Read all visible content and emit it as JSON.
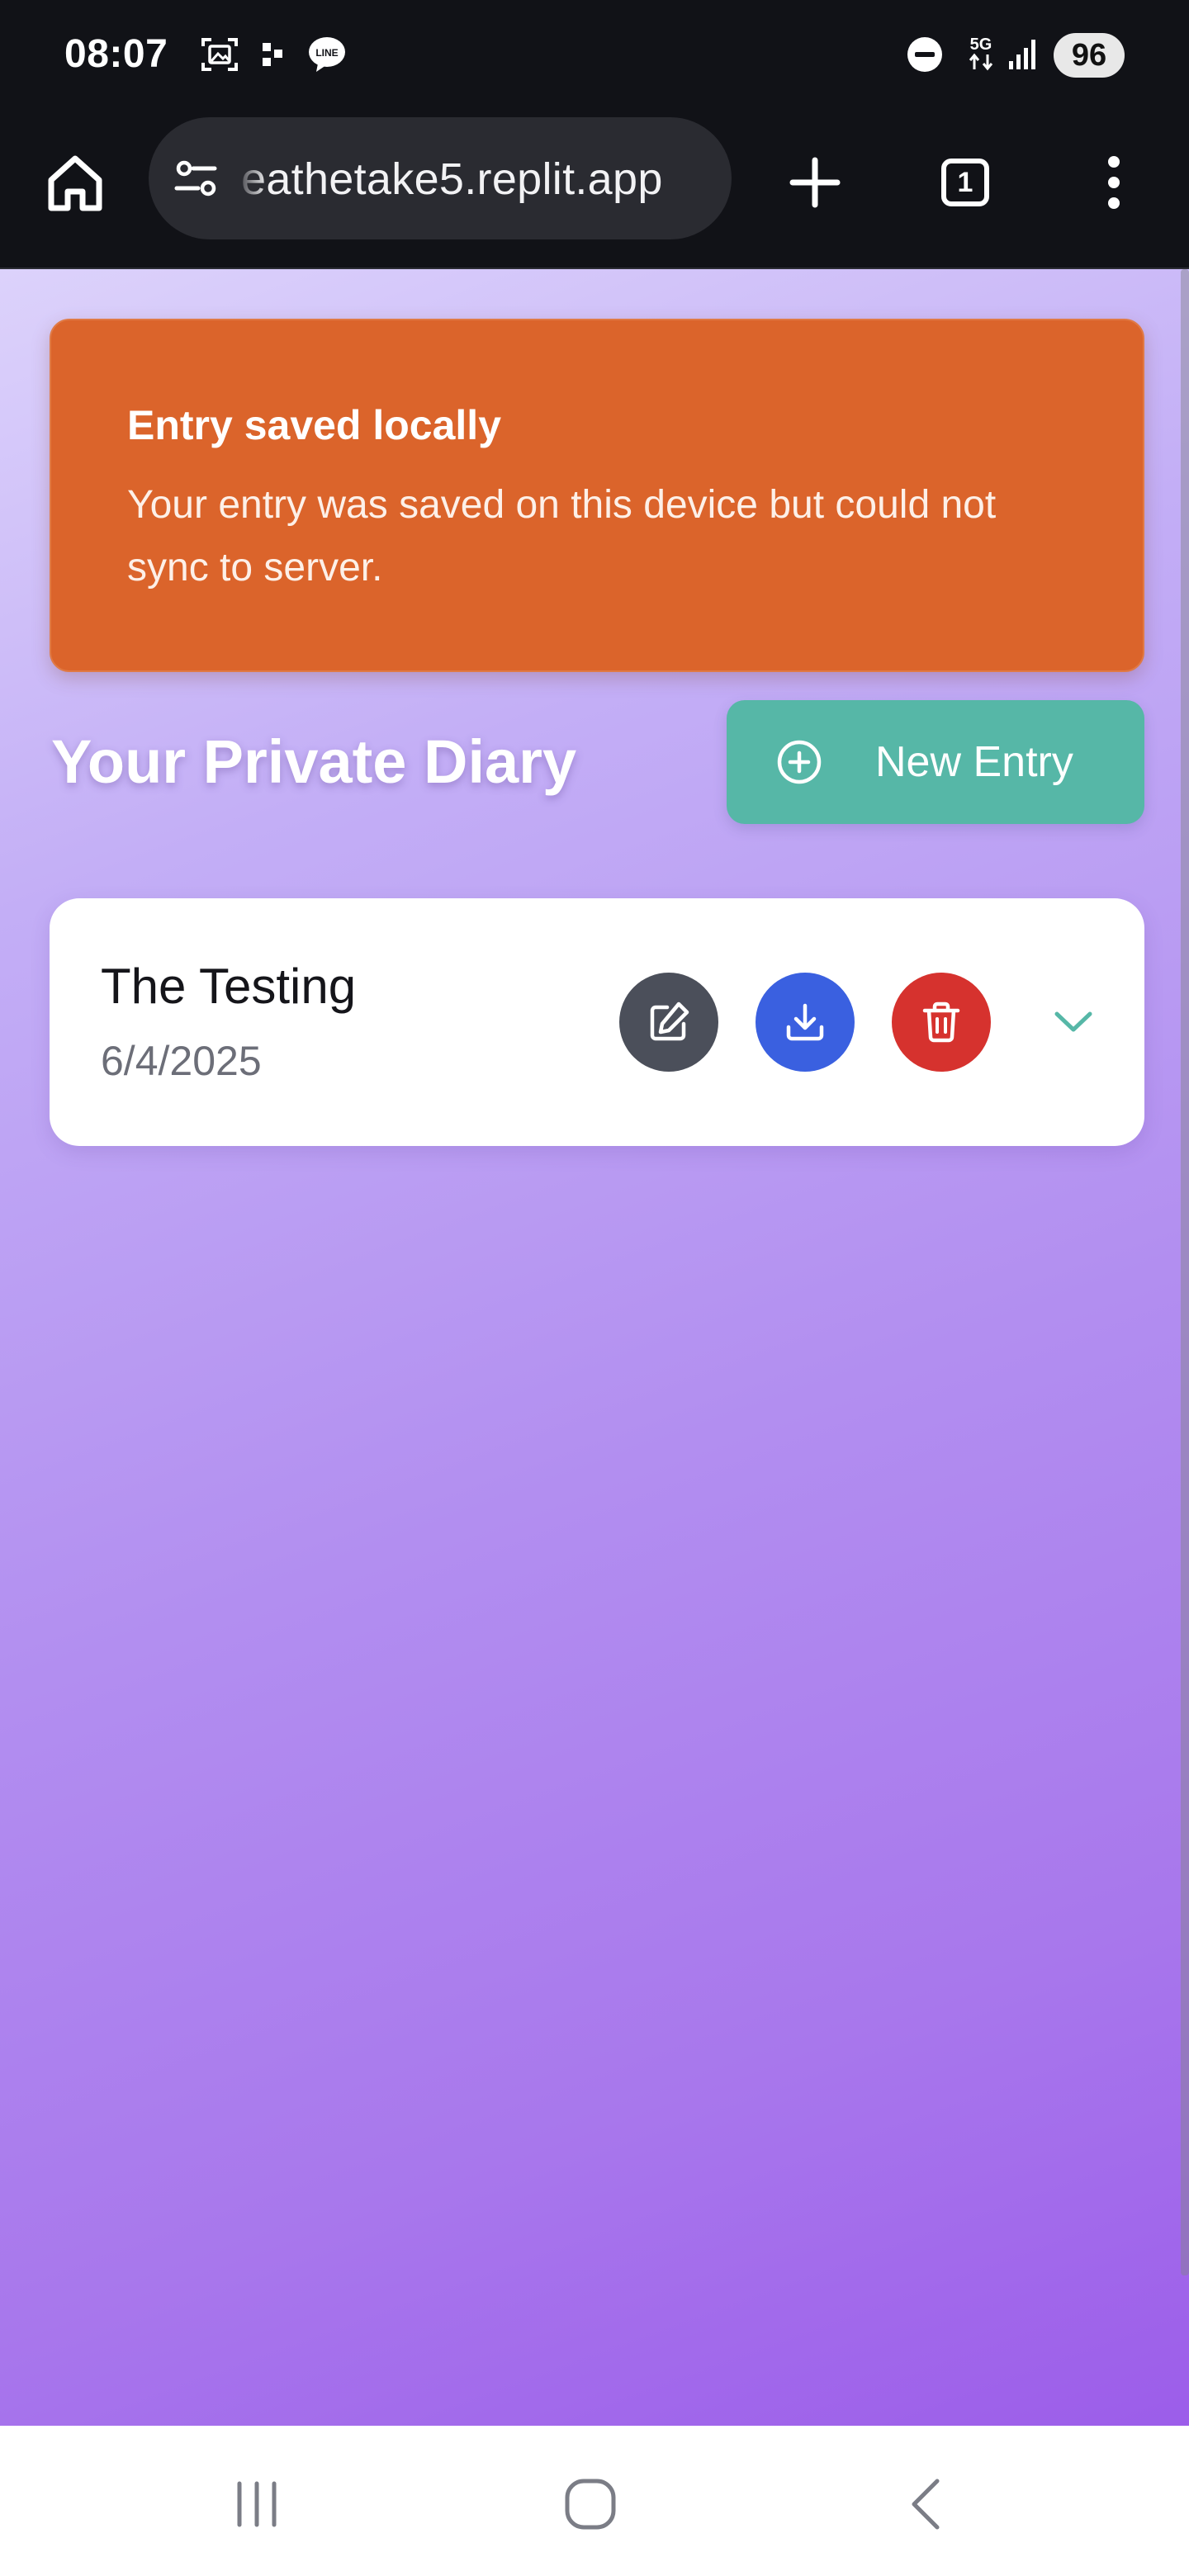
{
  "status_bar": {
    "time": "08:07",
    "network": "5G",
    "battery": "96",
    "icons": [
      "screenshot-icon",
      "app-grid-icon",
      "line-app-icon",
      "do-not-disturb-icon",
      "network-5g-icon",
      "signal-icon"
    ],
    "line_badge": "LINE"
  },
  "browser": {
    "url": "eathetake5.replit.app",
    "tab_count": "1",
    "icons": [
      "home-icon",
      "tune-icon",
      "plus-icon",
      "tabs-icon",
      "more-vert-icon"
    ]
  },
  "toast": {
    "title": "Entry saved locally",
    "message": "Your entry was saved on this device but could not sync to server.",
    "color": "#db642b"
  },
  "page": {
    "title": "Your Private Diary",
    "new_entry_label": "New Entry",
    "accent_color": "#56b7a7"
  },
  "entries": [
    {
      "title": "The Testing",
      "date": "6/4/2025",
      "actions": [
        {
          "name": "edit",
          "icon": "edit-icon",
          "color": "#4b4f5a"
        },
        {
          "name": "download",
          "icon": "download-icon",
          "color": "#3a60e0"
        },
        {
          "name": "delete",
          "icon": "trash-icon",
          "color": "#d6322e"
        }
      ],
      "expand_icon": "chevron-down-icon"
    }
  ],
  "nav_bar": {
    "icons": [
      "recents-icon",
      "home-circle-icon",
      "back-icon"
    ]
  }
}
